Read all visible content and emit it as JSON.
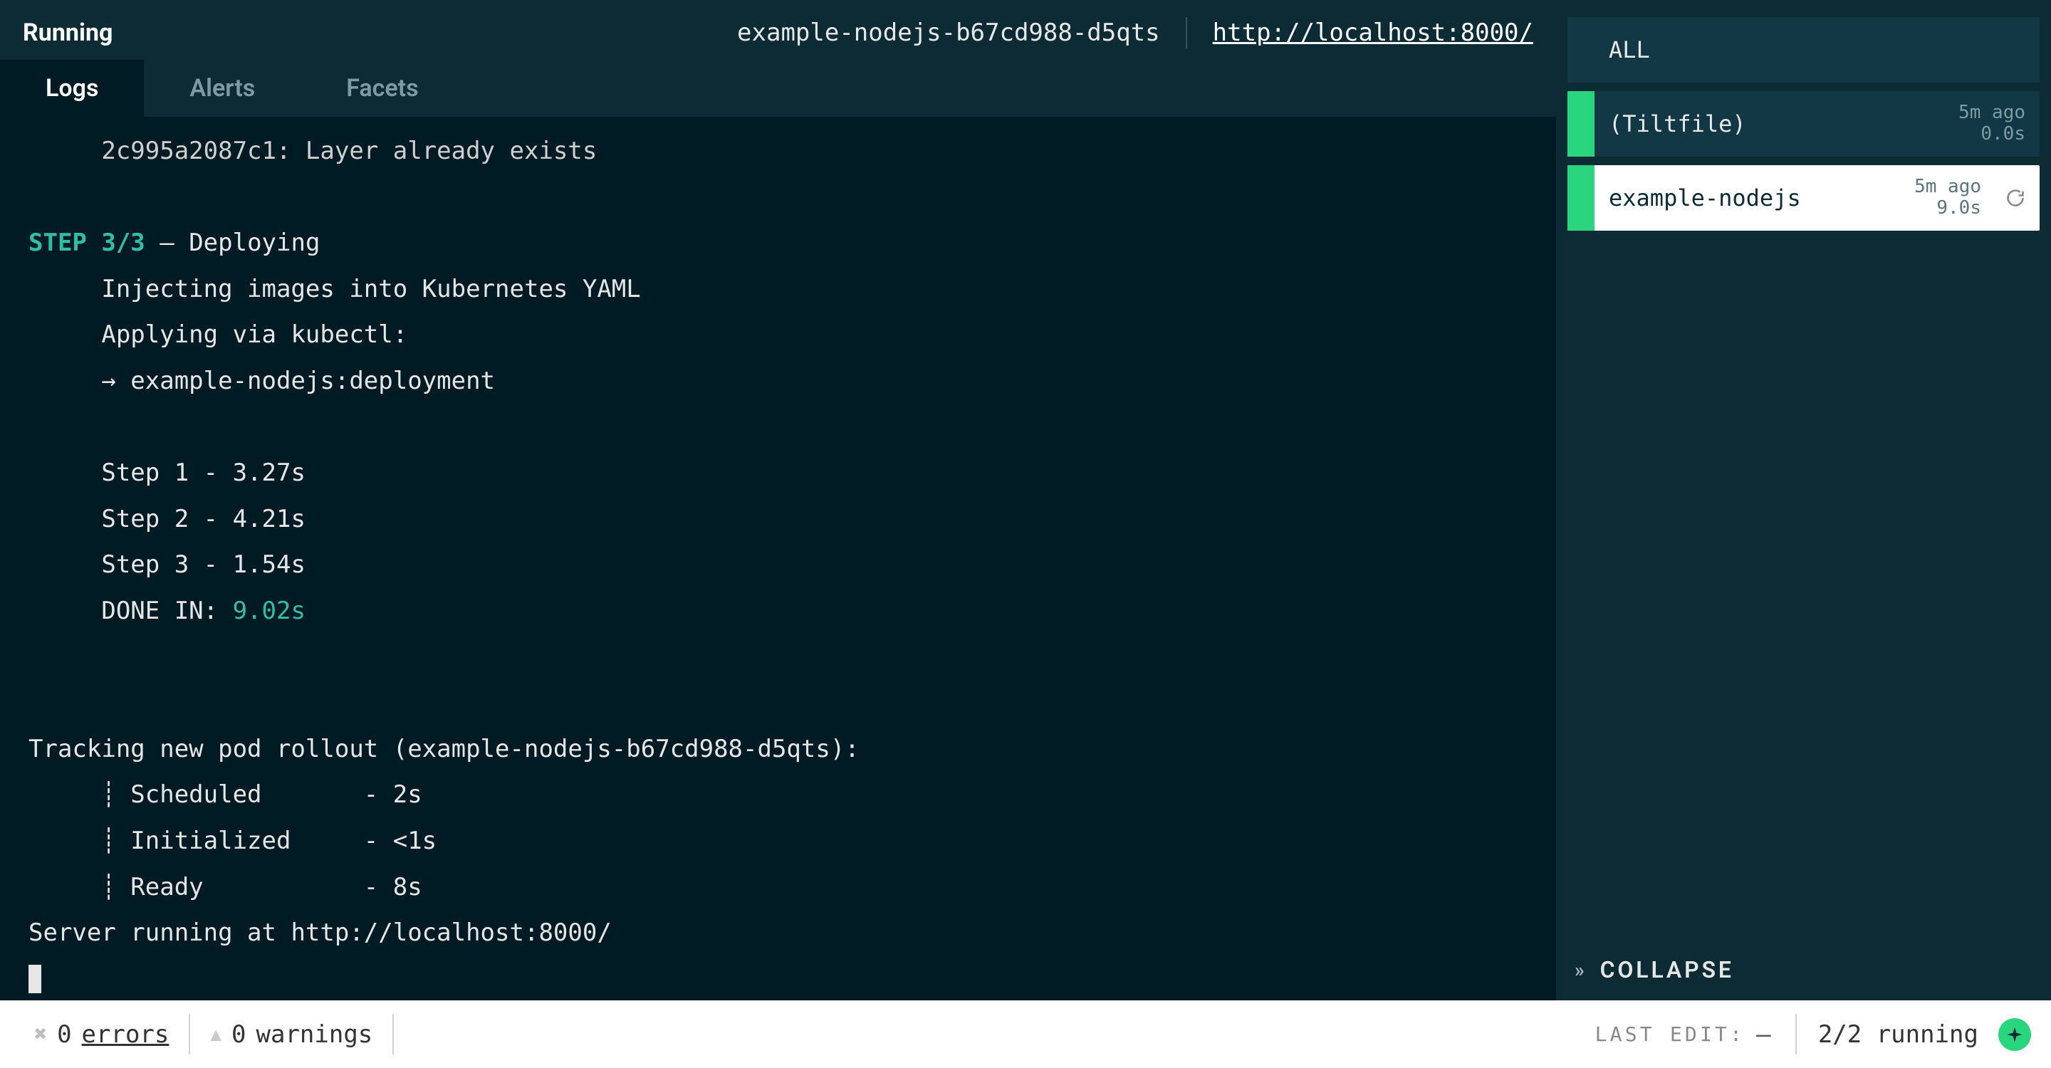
{
  "header": {
    "status": "Running",
    "pod_name": "example-nodejs-b67cd988-d5qts",
    "url": "http://localhost:8000/"
  },
  "tabs": {
    "logs": "Logs",
    "alerts": "Alerts",
    "facets": "Facets"
  },
  "logs": {
    "line_layer": "     2c995a2087c1: Layer already exists",
    "step_label": "STEP 3/3",
    "step_dash": " — ",
    "step_title": "Deploying",
    "inject": "     Injecting images into Kubernetes YAML",
    "apply": "     Applying via kubectl:",
    "arrow": "     → example-nodejs:deployment",
    "s1": "     Step 1 - 3.27s",
    "s2": "     Step 2 - 4.21s",
    "s3": "     Step 3 - 1.54s",
    "done_prefix": "     DONE IN: ",
    "done_time": "9.02s",
    "track": "Tracking new pod rollout (example-nodejs-b67cd988-d5qts):",
    "sched": "     ┊ Scheduled       - 2s",
    "init": "     ┊ Initialized     - <1s",
    "ready": "     ┊ Ready           - 8s",
    "server": "Server running at http://localhost:8000/"
  },
  "sidebar": {
    "all": "ALL",
    "tiltfile": {
      "name": "(Tiltfile)",
      "age": "5m ago",
      "dur": "0.0s"
    },
    "example": {
      "name": "example-nodejs",
      "age": "5m ago",
      "dur": "9.0s"
    },
    "collapse": "COLLAPSE"
  },
  "statusbar": {
    "errors_count": "0",
    "errors_label": "errors",
    "warnings_count": "0",
    "warnings_label": "warnings",
    "last_edit_label": "LAST EDIT:",
    "last_edit_value": "—",
    "running": "2/2 running"
  }
}
